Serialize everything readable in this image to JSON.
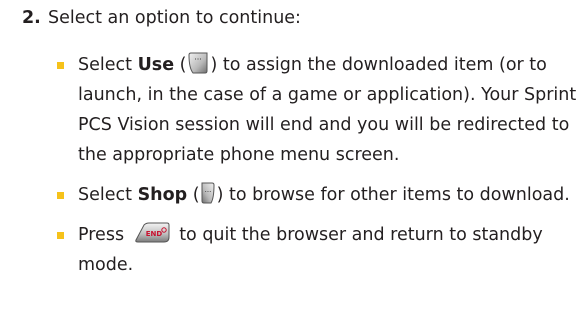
{
  "step": {
    "number": "2.",
    "text": "Select an option to continue:"
  },
  "bullets": [
    {
      "pre": "Select ",
      "bold": "Use",
      "open_paren": " (",
      "icon": "left-softkey-icon",
      "post": ") to assign the downloaded item (or to launch, in the case of a game or application). Your Sprint PCS Vision session will end and you will be redirected to the appropriate phone menu screen."
    },
    {
      "pre": "Select ",
      "bold": "Shop",
      "open_paren": " (",
      "icon": "right-softkey-icon",
      "post": ") to browse for other items to download."
    },
    {
      "pre": "Press ",
      "icon": "end-key-icon",
      "icon_label": "END",
      "post": " to quit the browser and return to standby mode."
    }
  ],
  "colors": {
    "bullet": "#f6c21a",
    "text": "#231f20",
    "end_key_text": "#c8102e"
  }
}
